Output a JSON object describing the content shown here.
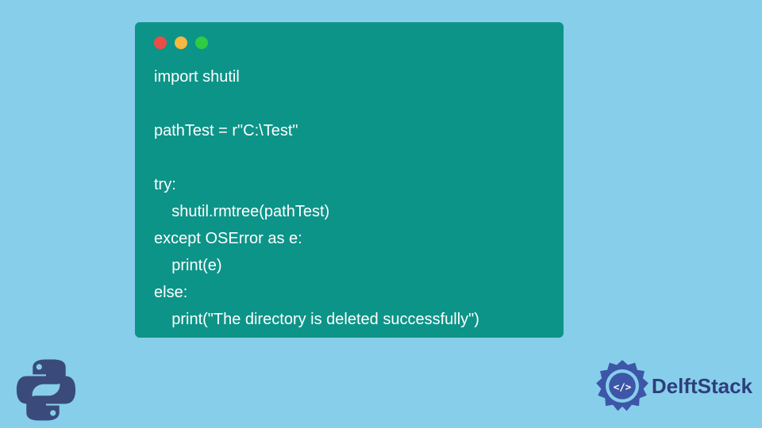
{
  "code": {
    "lines": [
      "import shutil",
      "",
      "pathTest = r\"C:\\Test\"",
      "",
      "try:",
      "    shutil.rmtree(pathTest)",
      "except OSError as e:",
      "    print(e)",
      "else:",
      "    print(\"The directory is deleted successfully\")"
    ]
  },
  "window": {
    "dot_colors": [
      "#ec4c47",
      "#f5b843",
      "#2ecc40"
    ]
  },
  "branding": {
    "site_name": "DelftStack"
  },
  "icons": {
    "python": "python-logo-icon",
    "delft": "delft-gear-icon"
  }
}
